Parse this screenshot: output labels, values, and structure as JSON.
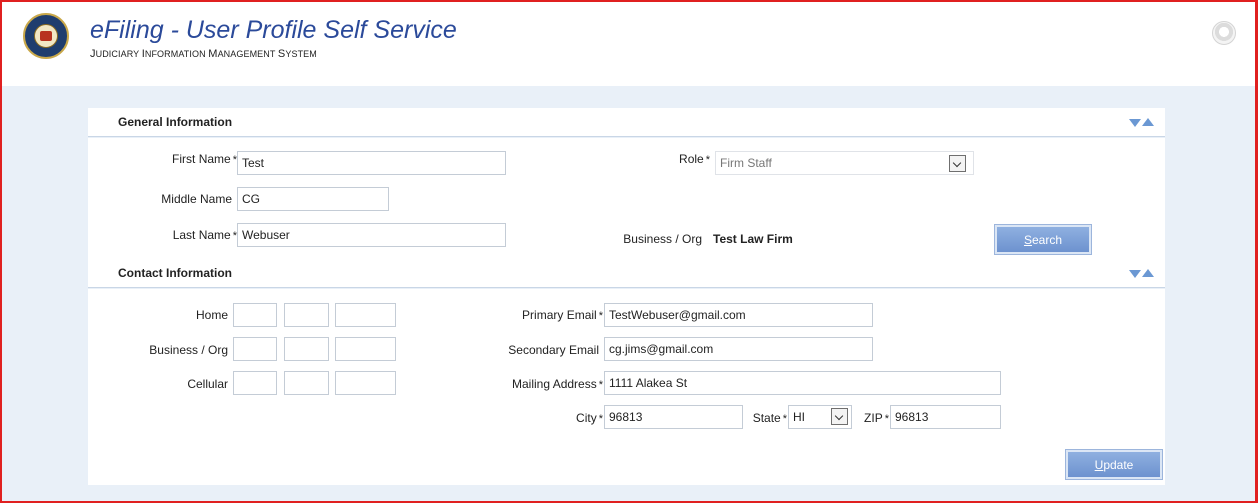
{
  "header": {
    "title": "eFiling - User Profile Self Service",
    "subtitle_first_letters": [
      "J",
      "I",
      "M",
      "S"
    ],
    "subtitle_words_rest": [
      "UDICIARY",
      "NFORMATION",
      "ANAGEMENT",
      "YSTEM"
    ]
  },
  "general": {
    "section_title": "General Information",
    "first_name": {
      "label": "First Name",
      "required": "*",
      "value": "Test"
    },
    "middle_name": {
      "label": "Middle Name",
      "value": "CG"
    },
    "last_name": {
      "label": "Last Name",
      "required": "*",
      "value": "Webuser"
    },
    "role": {
      "label": "Role",
      "required": "*",
      "value": "Firm Staff"
    },
    "business_org": {
      "label": "Business / Org",
      "value": "Test Law Firm"
    },
    "search_button": {
      "accesskey": "S",
      "rest": "earch"
    }
  },
  "contact": {
    "section_title": "Contact Information",
    "phones": [
      {
        "label": "Home"
      },
      {
        "label": "Business / Org"
      },
      {
        "label": "Cellular"
      }
    ],
    "primary_email": {
      "label": "Primary Email",
      "required": "*",
      "value": "TestWebuser@gmail.com"
    },
    "secondary_email": {
      "label": "Secondary Email",
      "value": "cg.jims@gmail.com"
    },
    "mailing_address": {
      "label": "Mailing Address",
      "required": "*",
      "value": "1111 Alakea St"
    },
    "city": {
      "label": "City",
      "required": "*",
      "value": "96813"
    },
    "state": {
      "label": "State",
      "required": "*",
      "value": "HI"
    },
    "zip": {
      "label": "ZIP",
      "required": "*",
      "value": "96813"
    },
    "update_button": {
      "accesskey": "U",
      "rest": "pdate"
    }
  },
  "colors": {
    "frame_border": "#e02020",
    "title": "#2b4a9a",
    "background": "#e9f0f8",
    "button": "#7a9fd6"
  }
}
